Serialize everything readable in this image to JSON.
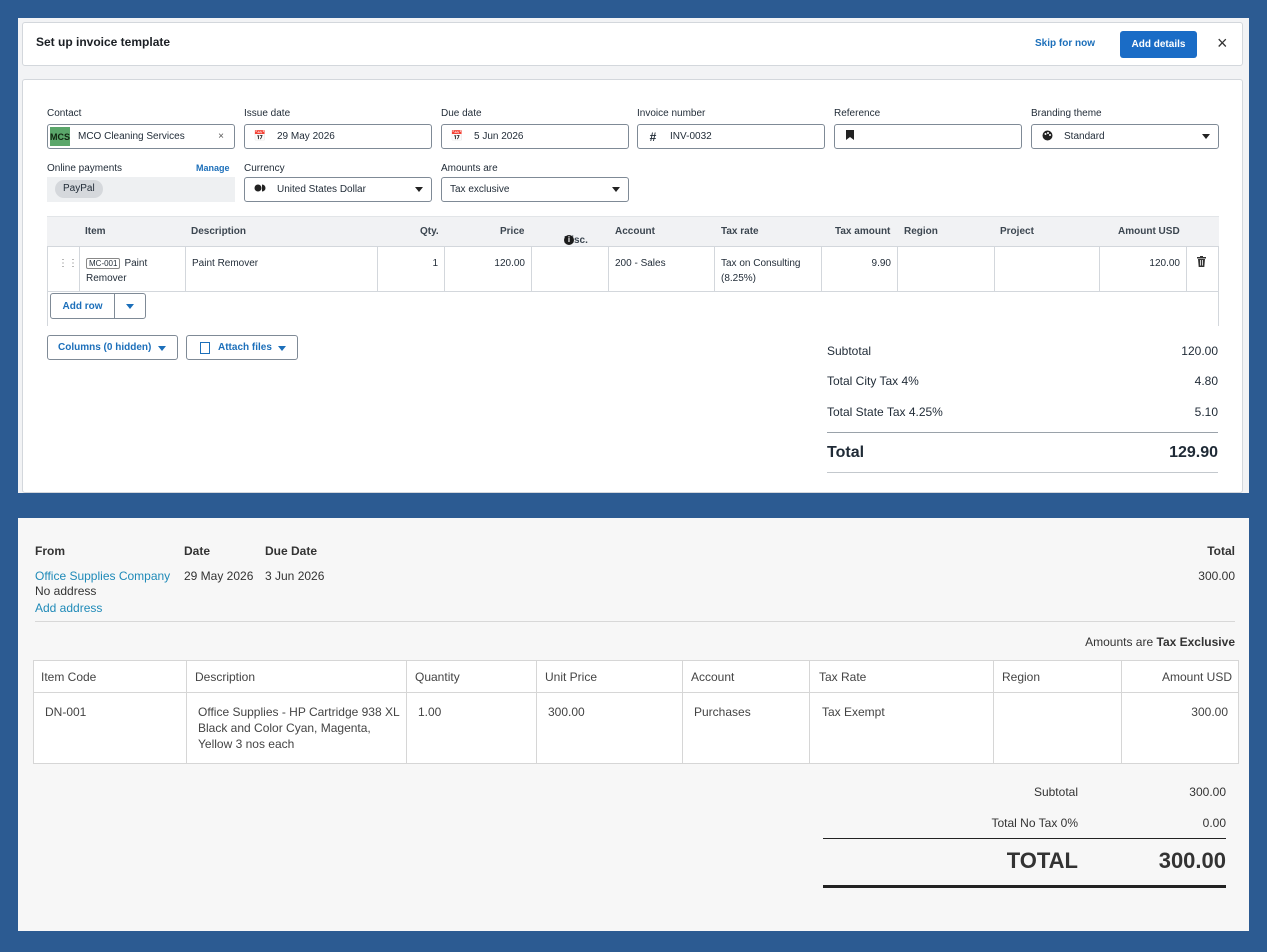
{
  "top": {
    "title": "Set up invoice template",
    "skip": "Skip for now",
    "add_details": "Add details",
    "close": "×",
    "fields": {
      "contact_label": "Contact",
      "contact_badge": "MCS",
      "contact_value": "MCO Cleaning Services",
      "contact_clear": "×",
      "issue_label": "Issue date",
      "issue_value": "29 May 2026",
      "due_label": "Due date",
      "due_value": "5 Jun 2026",
      "invnum_label": "Invoice number",
      "invnum_value": "INV-0032",
      "ref_label": "Reference",
      "ref_value": "",
      "brand_label": "Branding theme",
      "brand_value": "Standard",
      "online_label": "Online payments",
      "manage": "Manage",
      "paypal": "PayPal",
      "currency_label": "Currency",
      "currency_value": "United States Dollar",
      "amounts_label": "Amounts are",
      "amounts_value": "Tax exclusive"
    },
    "table": {
      "headers": [
        "Item",
        "Description",
        "Qty.",
        "Price",
        "Disc.",
        "Account",
        "Tax rate",
        "Tax amount",
        "Region",
        "Project",
        "Amount USD"
      ],
      "row": {
        "code": "MC-001",
        "item_name": "Paint Remover",
        "description": "Paint Remover",
        "qty": "1",
        "price": "120.00",
        "disc": "",
        "account": "200 - Sales",
        "tax_rate": "Tax on Consulting (8.25%)",
        "tax_amount": "9.90",
        "region": "",
        "project": "",
        "amount": "120.00"
      }
    },
    "add_row": "Add row",
    "columns_btn": "Columns (0 hidden)",
    "attach_btn": "Attach files",
    "totals": {
      "subtotal_label": "Subtotal",
      "subtotal": "120.00",
      "city_label": "Total City Tax 4%",
      "city": "4.80",
      "state_label": "Total State Tax 4.25%",
      "state": "5.10",
      "total_label": "Total",
      "total": "129.90"
    }
  },
  "bottom": {
    "from_label": "From",
    "date_label": "Date",
    "due_label": "Due Date",
    "total_label": "Total",
    "from_value": "Office Supplies Company",
    "date_value": "29 May 2026",
    "due_value": "3 Jun 2026",
    "total_value": "300.00",
    "no_address": "No address",
    "add_address": "Add address",
    "amounts_prefix": "Amounts are",
    "amounts_value": "Tax Exclusive",
    "table": {
      "headers": [
        "Item Code",
        "Description",
        "Quantity",
        "Unit Price",
        "Account",
        "Tax Rate",
        "Region",
        "Amount USD"
      ],
      "row": {
        "code": "DN-001",
        "description": "Office Supplies - HP Cartridge 938 XL Black and Color Cyan, Magenta, Yellow 3 nos each",
        "quantity": "1.00",
        "unit_price": "300.00",
        "account": "Purchases",
        "tax_rate": "Tax Exempt",
        "region": "",
        "amount": "300.00"
      }
    },
    "totals": {
      "subtotal_label": "Subtotal",
      "subtotal": "300.00",
      "notax_label": "Total No Tax 0%",
      "notax": "0.00",
      "total_label": "TOTAL",
      "total": "300.00"
    }
  },
  "colors": {
    "background": "#2c5b92",
    "primary_button": "#1a6cc6",
    "link": "#1c6fba",
    "contact_badge": "#5aa66a"
  }
}
